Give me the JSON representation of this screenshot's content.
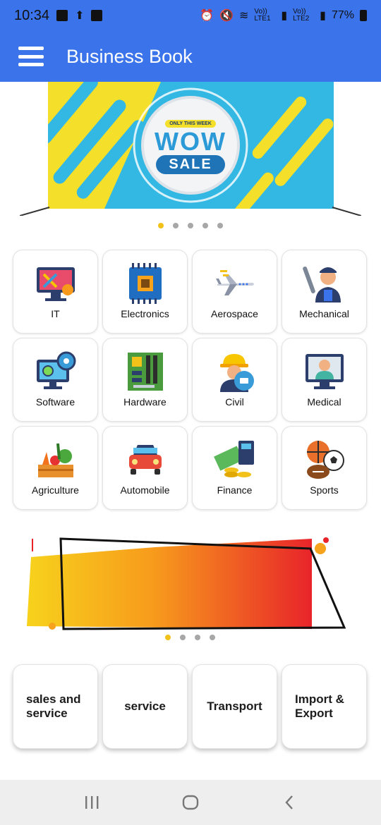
{
  "status_bar": {
    "time": "10:34",
    "lte1": "Vo)) LTE1",
    "lte2": "Vo)) LTE2",
    "battery": "77%"
  },
  "app_bar": {
    "title": "Business Book"
  },
  "banner1": {
    "tag": "ONLY THIS WEEK",
    "headline": "WOW",
    "button": "SALE",
    "page_indicator": {
      "count": 5,
      "active": 1
    }
  },
  "categories": [
    {
      "label": "IT",
      "icon": "it-icon"
    },
    {
      "label": "Electronics",
      "icon": "chip-icon"
    },
    {
      "label": "Aerospace",
      "icon": "airplane-icon"
    },
    {
      "label": "Mechanical",
      "icon": "mechanic-icon"
    },
    {
      "label": "Software",
      "icon": "software-icon"
    },
    {
      "label": "Hardware",
      "icon": "motherboard-icon"
    },
    {
      "label": "Civil",
      "icon": "engineer-icon"
    },
    {
      "label": "Medical",
      "icon": "doctor-icon"
    },
    {
      "label": "Agriculture",
      "icon": "vegetables-icon"
    },
    {
      "label": "Automobile",
      "icon": "car-icon"
    },
    {
      "label": "Finance",
      "icon": "money-icon"
    },
    {
      "label": "Sports",
      "icon": "balls-icon"
    }
  ],
  "banner2": {
    "page_indicator": {
      "count": 4,
      "active": 1
    }
  },
  "services": [
    {
      "label": "sales and service"
    },
    {
      "label": "service"
    },
    {
      "label": "Transport"
    },
    {
      "label": "Import & Export"
    }
  ],
  "colors": {
    "primary": "#3a73ea",
    "accent": "#f2c21b",
    "dot": "#a7a7a7"
  }
}
